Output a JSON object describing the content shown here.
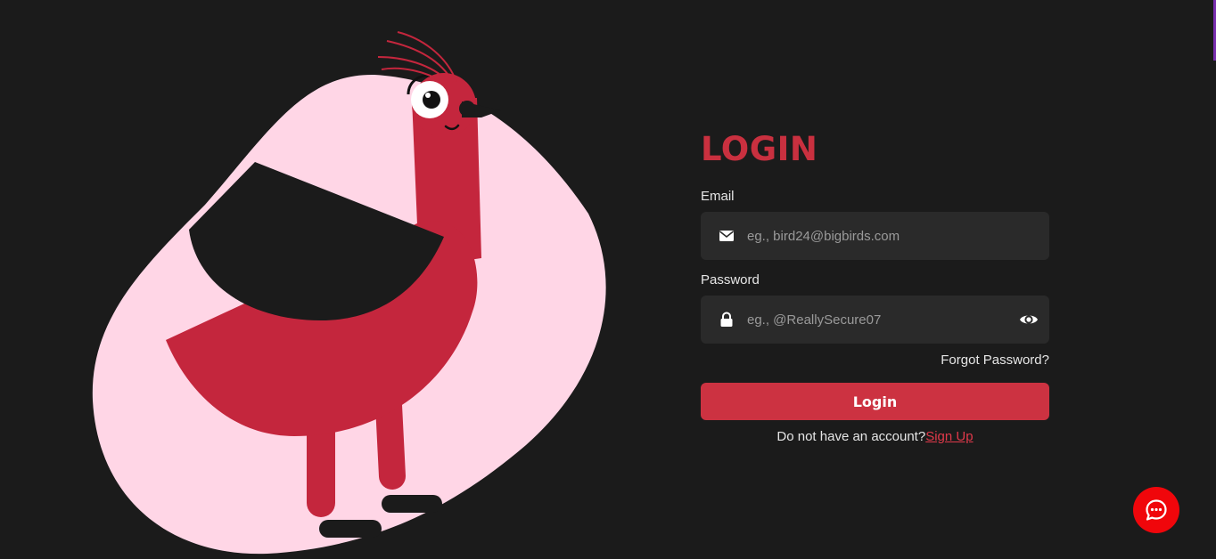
{
  "login": {
    "title": "LOGIN",
    "email": {
      "label": "Email",
      "placeholder": "eg., bird24@bigbirds.com",
      "value": "",
      "icon": "envelope-icon"
    },
    "password": {
      "label": "Password",
      "placeholder": "eg., @ReallySecure07",
      "value": "",
      "icon": "lock-icon",
      "toggle_icon": "eye-icon"
    },
    "forgot_password": "Forgot Password?",
    "submit_label": "Login",
    "signup_prompt": "Do not have an account?",
    "signup_link": "Sign Up"
  },
  "chat": {
    "icon": "chat-bubble-icon"
  },
  "colors": {
    "background": "#1b1b1b",
    "accent": "#cc3241",
    "title": "#c9303f",
    "input_background": "#2a2a2a",
    "blob": "#ffd6e6",
    "bird": "#c4263d",
    "chat_button": "#f0060b"
  }
}
